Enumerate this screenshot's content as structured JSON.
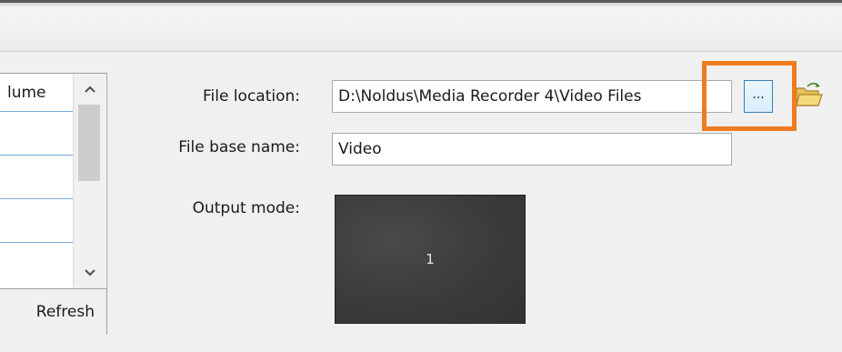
{
  "list": {
    "column_header": "lume",
    "refresh_label": "Refresh"
  },
  "form": {
    "file_location_label": "File location:",
    "file_location_value": "D:\\Noldus\\Media Recorder 4\\Video Files",
    "browse_label": "...",
    "file_base_name_label": "File base name:",
    "file_base_name_value": "Video",
    "output_mode_label": "Output mode:",
    "output_mode_cell": "1"
  },
  "icons": {
    "scroll_up": "chevron-up-icon",
    "scroll_down": "chevron-down-icon",
    "open_folder": "open-folder-icon"
  },
  "colors": {
    "highlight": "#f07c1f",
    "preview_bg": "#3b3b3b"
  }
}
